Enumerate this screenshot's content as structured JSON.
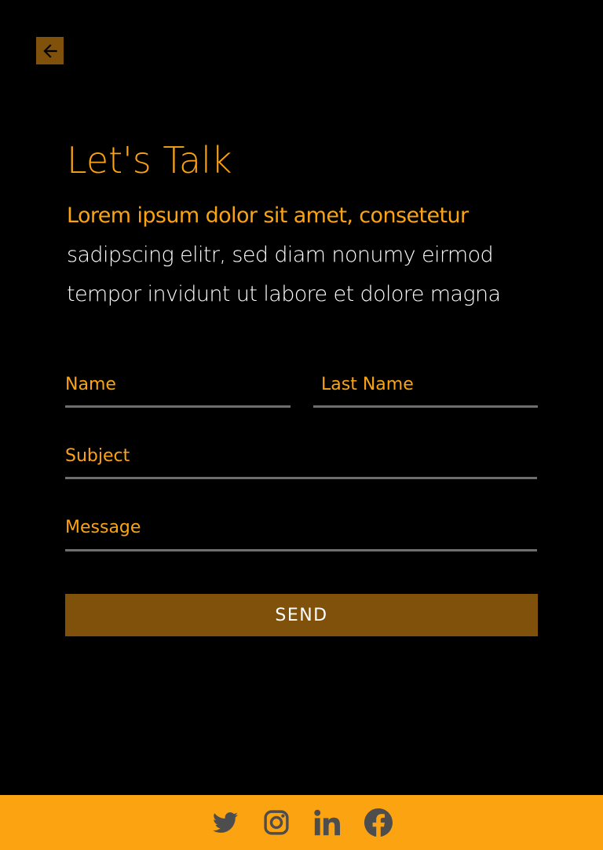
{
  "header": {
    "back_icon": "arrow-left-icon"
  },
  "main": {
    "title": "Let's Talk",
    "intro_highlight": "Lorem ipsum dolor sit amet, consetetur",
    "intro_line_2": "sadipscing elitr, sed diam nonumy eirmod",
    "intro_line_3": "tempor invidunt ut labore et dolore magna"
  },
  "form": {
    "first_name_placeholder": "Name",
    "last_name_placeholder": "Last Name",
    "subject_placeholder": "Subject",
    "message_placeholder": "Message",
    "send_label": "SEND"
  },
  "footer": {
    "social": [
      {
        "icon": "twitter-icon"
      },
      {
        "icon": "instagram-icon"
      },
      {
        "icon": "linkedin-icon"
      },
      {
        "icon": "facebook-icon"
      }
    ]
  },
  "colors": {
    "background": "#000000",
    "accent": "#fca311",
    "accent_dark": "#7f510a",
    "underline": "#6e6e6e",
    "icon": "#4d4d4d"
  }
}
